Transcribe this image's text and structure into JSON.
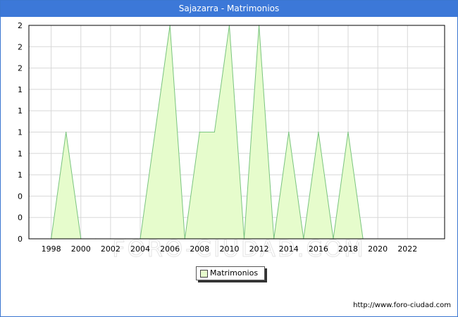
{
  "title": "Sajazarra - Matrimonios",
  "watermark": "FORO-CIUDAD.COM",
  "footer_url": "http://www.foro-ciudad.com",
  "colors": {
    "title_bar": "#3c78d8",
    "area_fill": "#e6fccc",
    "area_line": "#7ac47f",
    "grid": "#d8d8d8"
  },
  "chart_data": {
    "type": "area",
    "title": "Sajazarra - Matrimonios",
    "x": [
      1998,
      1999,
      2000,
      2001,
      2002,
      2003,
      2004,
      2005,
      2006,
      2007,
      2008,
      2009,
      2010,
      2011,
      2012,
      2013,
      2014,
      2015,
      2016,
      2017,
      2018,
      2019
    ],
    "series": [
      {
        "name": "Matrimonios",
        "values": [
          0,
          1,
          0,
          0,
          0,
          0,
          0,
          1,
          2,
          0,
          1,
          1,
          2,
          0,
          2,
          0,
          1,
          0,
          1,
          0,
          1,
          0
        ]
      }
    ],
    "xlim": [
      1996.5,
      2024.5
    ],
    "ylim": [
      0,
      2
    ],
    "x_ticks": [
      1998,
      2000,
      2002,
      2004,
      2006,
      2008,
      2010,
      2012,
      2014,
      2016,
      2018,
      2020,
      2022
    ],
    "y_tick_labels": [
      "0",
      "0",
      "0",
      "1",
      "1",
      "1",
      "1",
      "1",
      "2",
      "2",
      "2"
    ],
    "grid": true,
    "legend_position": "bottom-center"
  }
}
